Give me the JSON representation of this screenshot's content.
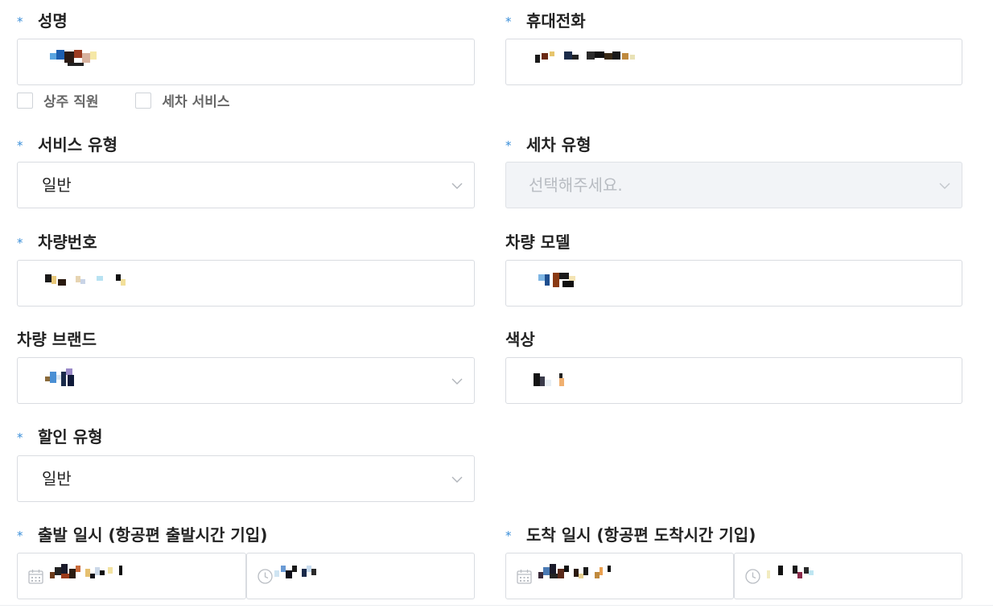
{
  "form": {
    "name": {
      "label": "성명",
      "required": true
    },
    "phone": {
      "label": "휴대전화",
      "required": true
    },
    "checkboxes": [
      {
        "label": "상주 직원",
        "checked": false
      },
      {
        "label": "세차 서비스",
        "checked": false
      }
    ],
    "service_type": {
      "label": "서비스 유형",
      "required": true,
      "value": "일반"
    },
    "wash_type": {
      "label": "세차 유형",
      "required": true,
      "placeholder": "선택해주세요.",
      "disabled": true
    },
    "plate_number": {
      "label": "차량번호",
      "required": true
    },
    "car_model": {
      "label": "차량 모델",
      "required": false
    },
    "car_brand": {
      "label": "차량 브랜드",
      "required": false
    },
    "color": {
      "label": "색상",
      "required": false
    },
    "discount_type": {
      "label": "할인 유형",
      "required": true,
      "value": "일반"
    },
    "departure": {
      "label": "출발 일시 (항공편 출발시간 기입)",
      "required": true
    },
    "arrival": {
      "label": "도착 일시 (항공편 도착시간 기입)",
      "required": true
    },
    "required_mark": "*"
  },
  "colors": {
    "required_mark": "#3b8fd9",
    "border": "#d9dce1",
    "disabled_bg": "#f2f4f7"
  }
}
